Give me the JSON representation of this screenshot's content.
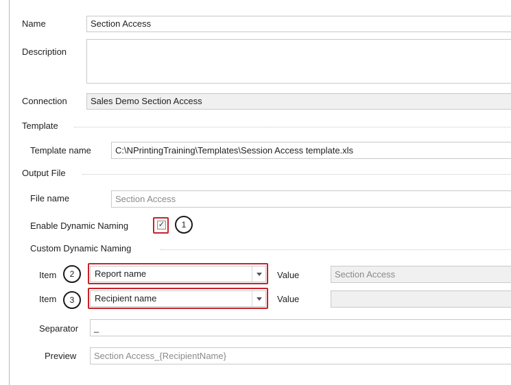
{
  "general": {
    "name_label": "Name",
    "name_value": "Section Access",
    "description_label": "Description",
    "description_value": "",
    "connection_label": "Connection",
    "connection_value": "Sales Demo Section Access"
  },
  "template": {
    "section_label": "Template",
    "name_label": "Template name",
    "name_value": "C:\\NPrintingTraining\\Templates\\Session Access template.xls"
  },
  "output": {
    "section_label": "Output File",
    "file_name_label": "File name",
    "file_name_value": "Section Access",
    "dynamic_naming_label": "Enable Dynamic Naming",
    "dynamic_naming_checked": true,
    "checkbox_glyph": "✓"
  },
  "custom_naming": {
    "section_label": "Custom Dynamic Naming",
    "items": [
      {
        "item_label": "Item",
        "selected": "Report name",
        "value_label": "Value",
        "value": "Section Access"
      },
      {
        "item_label": "Item",
        "selected": "Recipient name",
        "value_label": "Value",
        "value": ""
      }
    ],
    "separator_label": "Separator",
    "separator_value": "_",
    "preview_label": "Preview",
    "preview_value": "Section Access_{RecipientName}"
  },
  "callouts": [
    "1",
    "2",
    "3"
  ],
  "colors": {
    "highlight": "#c8202a",
    "border": "#c8c8c8",
    "readonly_bg": "#f0f0f0"
  }
}
